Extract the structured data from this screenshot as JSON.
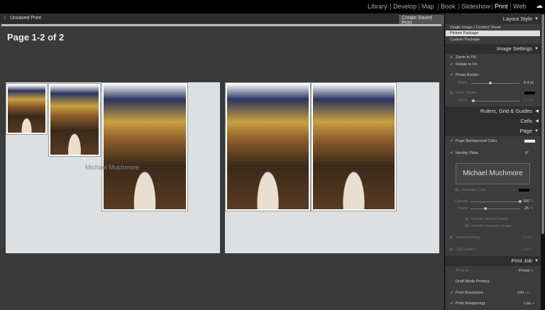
{
  "modules": [
    "Library",
    "Develop",
    "Map",
    "Book",
    "Slideshow",
    "Print",
    "Web"
  ],
  "active_module": "Print",
  "toolbar": {
    "title": "Unsaved Print",
    "create_button": "Create Saved Print"
  },
  "page_title": "Page 1-2 of 2",
  "identity_plate_text": "Michael Muchmore",
  "panel": {
    "layout_style": {
      "title": "Layout Style",
      "options": [
        "Single Image / Contact Sheet",
        "Picture Package",
        "Custom Package"
      ],
      "selected": "Picture Package"
    },
    "image_settings": {
      "title": "Image Settings",
      "zoom_to_fill": "Zoom to Fill",
      "rotate_to_fit": "Rotate to Fit",
      "photo_border": "Photo Border",
      "width_label": "Width",
      "border_width": "8.4 pt",
      "inner_stroke": "Inner Stroke",
      "stroke_width": "0.2 pt"
    },
    "rulers": "Rulers, Grid & Guides",
    "cells": "Cells",
    "page": {
      "title": "Page",
      "bg_color": "Page Background Color",
      "identity_plate": "Identity Plate",
      "angle": "0°",
      "plate_text": "Michael Muchmore",
      "override_color": "Override Color",
      "opacity_label": "Opacity",
      "opacity": "100",
      "scale_label": "Scale",
      "scale": "25",
      "pct": "%",
      "render_behind": "Render behind image",
      "render_every": "Render on every image",
      "watermarking": "Watermarking :",
      "watermark_value": "None ÷",
      "cut_guides": "Cut Guides :",
      "cut_value": "Lines ÷"
    },
    "print_job": {
      "title": "Print Job",
      "print_to": "Print to :",
      "print_to_value": "Printer ÷",
      "draft": "Draft Mode Printing",
      "resolution": "Print Resolution",
      "resolution_value": "240",
      "ppi": "ppi",
      "sharpening": "Print Sharpening :",
      "sharpening_value": "Low ÷"
    }
  },
  "slider_values": {
    "border_width": 0.4,
    "inner_stroke": 0.05,
    "opacity": 1.0,
    "scale": 0.3
  }
}
